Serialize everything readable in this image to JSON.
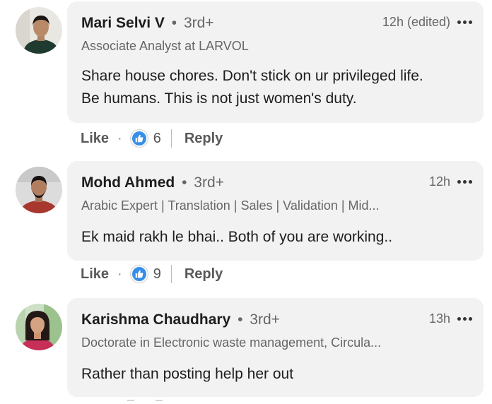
{
  "comments": [
    {
      "author": "Mari Selvi V",
      "separator": "•",
      "degree": "3rd+",
      "headline": "Associate Analyst at LARVOL",
      "time": "12h (edited)",
      "text_lines": [
        "Share house chores. Don't stick on ur privileged life.",
        "Be humans. This is not just women's duty."
      ],
      "like_label": "Like",
      "reaction_count": "6",
      "reply_label": "Reply"
    },
    {
      "author": "Mohd Ahmed",
      "separator": "•",
      "degree": "3rd+",
      "headline": "Arabic Expert | Translation | Sales | Validation | Mid...",
      "time": "12h",
      "text_lines": [
        "Ek maid rakh le bhai.. Both of you are working.."
      ],
      "like_label": "Like",
      "reaction_count": "9",
      "reply_label": "Reply"
    },
    {
      "author": "Karishma Chaudhary",
      "separator": "•",
      "degree": "3rd+",
      "headline": "Doctorate in Electronic waste management, Circula...",
      "time": "13h",
      "text_lines": [
        "Rather than posting help her out"
      ]
    }
  ],
  "action_separator": "·",
  "icons": {
    "more": "more-horizontal-icon",
    "reaction": "thumbs-up-icon"
  },
  "colors": {
    "bubble_bg": "#f2f2f2",
    "reaction_blue": "#378fe9",
    "muted_text": "#666666"
  }
}
